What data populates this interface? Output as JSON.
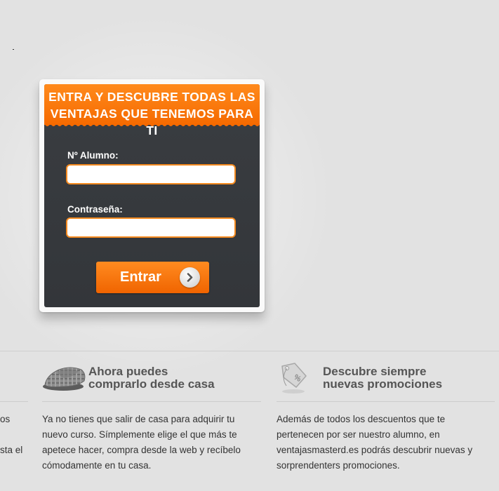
{
  "login": {
    "title_line1": "ENTRA Y DESCUBRE TODAS LAS",
    "title_line2": "VENTAJAS QUE TENEMOS PARA TI",
    "student_label": "Nº Alumno:",
    "student_value": "",
    "password_label": "Contraseña:",
    "password_value": "",
    "submit_label": "Entrar",
    "submit_icon": "chevron-right-icon"
  },
  "features": {
    "left_partial": {
      "line1": "os",
      "line2": "",
      "line3": "sta el"
    },
    "home": {
      "icon": "slipper-icon",
      "title_line1": "Ahora puedes",
      "title_line2": "comprarlo desde casa",
      "text_line1": "Ya no tienes que salir de casa para adquirir tu",
      "text_line2": "nuevo curso. Símplemente elige el que más te",
      "text_line3": "apetece hacer, compra desde la web y recíbelo",
      "text_line4": "cómodamente en tu casa."
    },
    "promos": {
      "icon": "discount-tag-icon",
      "title_line1": "Descubre siempre",
      "title_line2": "nuevas promociones",
      "text_line1": "Además de todos los descuentos que te",
      "text_line2": "pertenecen por ser nuestro alumno, en",
      "text_line3": "ventajasmasterd.es podrás descubrir nuevas y",
      "text_line4": "sorprendenters promociones."
    }
  },
  "colors": {
    "accent_orange": "#f56a00",
    "panel_dark": "#373a3e",
    "background": "#e2e2e2"
  }
}
